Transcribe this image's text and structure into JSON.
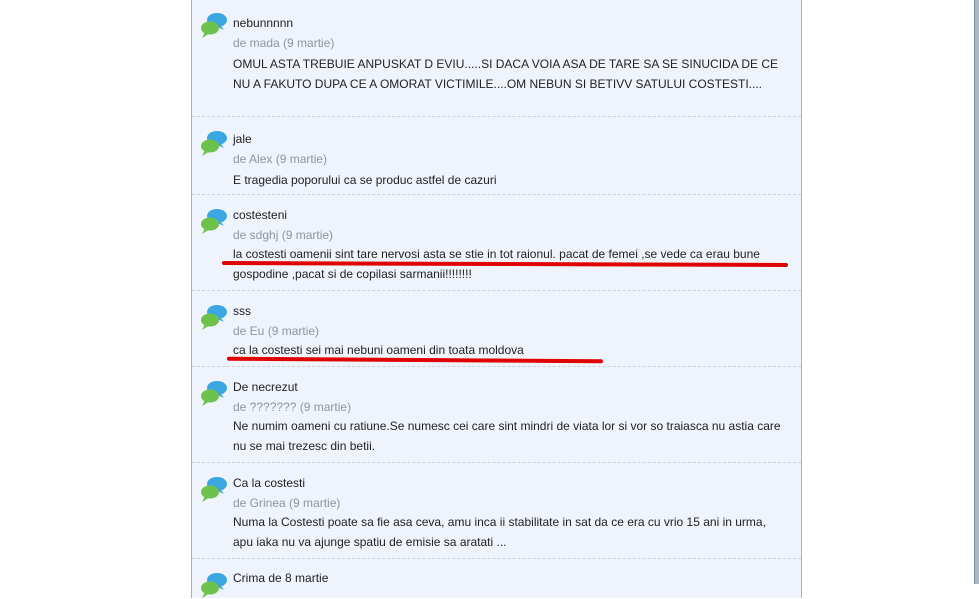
{
  "comments": [
    {
      "title": "nebunnnnn",
      "meta": "de mada (9 martie)",
      "text": "OMUL ASTA TREBUIE ANPUSKAT D EVIU.....SI DACA VOIA ASA DE TARE SA SE SINUCIDA DE CE NU A FAKUTO DUPA CE A OMORAT VICTIMILE....OM NEBUN SI BETIVV SATULUI COSTESTI...."
    },
    {
      "title": "jale",
      "meta": "de Alex (9 martie)",
      "text": "E tragedia poporului ca se produc astfel de cazuri"
    },
    {
      "title": "costesteni",
      "meta": "de sdghj (9 martie)",
      "text": "la costesti oamenii sint tare nervosi asta se stie in tot raionul. pacat de femei ,se vede ca erau bune gospodine ,pacat si de copilasi sarmanii!!!!!!!!"
    },
    {
      "title": "sss",
      "meta": "de Eu (9 martie)",
      "text": "ca la costesti sei mai nebuni oameni din toata moldova"
    },
    {
      "title": "De necrezut",
      "meta": "de ??????? (9 martie)",
      "text": "Ne numim oameni cu ratiune.Se numesc cei care sint mindri de viata lor si vor so traiasca nu astia care nu se mai trezesc din betii."
    },
    {
      "title": "Ca la costesti",
      "meta": "de Grinea (9 martie)",
      "text": "Numa la Costesti poate sa fie asa ceva, amu inca ii stabilitate in sat da ce era cu vrio 15 ani in urma, apu iaka nu va ajunge spatiu de emisie sa aratati ..."
    },
    {
      "title": "Crima de 8 martie",
      "meta": "",
      "text": ""
    }
  ],
  "colors": {
    "highlight": "#e00000",
    "panel": "#eff3fb",
    "meta": "#8e959f"
  }
}
